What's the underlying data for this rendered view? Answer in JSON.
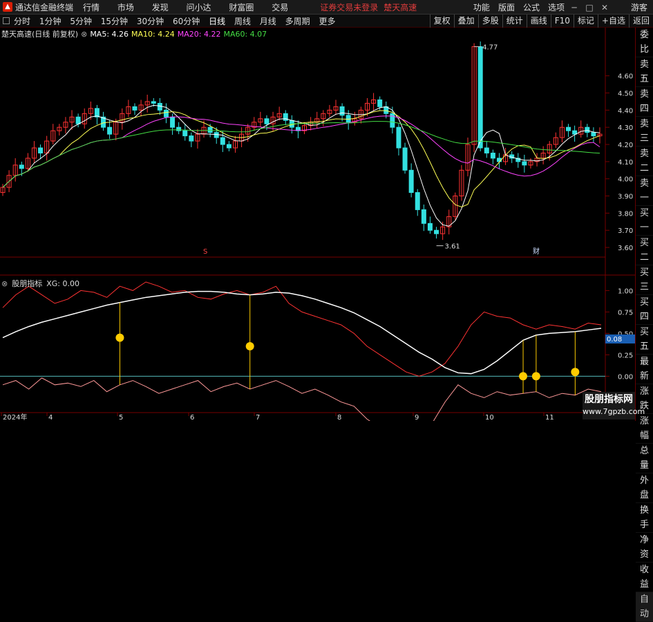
{
  "titlebar": {
    "app_name": "通达信金融终端",
    "menu": [
      "行情",
      "市场",
      "发现",
      "问小达",
      "财富圈",
      "交易"
    ],
    "warning": "证券交易未登录",
    "stock_name": "楚天高速",
    "right_menu": [
      "功能",
      "版面",
      "公式",
      "选项"
    ],
    "guest": "游客"
  },
  "toolbar": {
    "tabs": [
      "分时",
      "1分钟",
      "5分钟",
      "15分钟",
      "30分钟",
      "60分钟",
      "日线",
      "周线",
      "月线",
      "多周期",
      "更多"
    ],
    "active_tab": "日线",
    "right_buttons": [
      "复权",
      "叠加",
      "多股",
      "统计",
      "画线",
      "F10",
      "标记",
      "+自选",
      "返回"
    ]
  },
  "sidebar": {
    "items": [
      "委比",
      "卖五",
      "卖四",
      "卖三",
      "卖二",
      "卖一",
      "买一",
      "买二",
      "买三",
      "买四",
      "买五",
      "最新",
      "涨跌",
      "涨幅",
      "总量",
      "外盘",
      "换手",
      "净资",
      "收益",
      "自动"
    ]
  },
  "main_chart": {
    "label": "楚天高速(日线 前复权)",
    "ma5": "MA5: 4.26",
    "ma10": "MA10: 4.24",
    "ma20": "MA20: 4.22",
    "ma60": "MA60: 4.07",
    "high_label": "4.77",
    "low_label": "3.61",
    "marker_s": "S",
    "marker_cai": "财"
  },
  "indicator": {
    "label": "股朋指标",
    "xg": "XG: 0.00",
    "current_value": "0.08"
  },
  "x_axis": {
    "labels": [
      "2024年",
      "4",
      "5",
      "6",
      "7",
      "8",
      "9",
      "10",
      "11"
    ]
  },
  "watermark": {
    "line1": "股朋指标网",
    "line2": "www.7gpzb.com"
  },
  "colors": {
    "up": "#ff3333",
    "down": "#33e0e0",
    "ma5": "#ffffff",
    "ma10": "#ffff55",
    "ma20": "#ff44ff",
    "ma60": "#44dd44",
    "zero": "#55bbbb",
    "marker": "#ffcc00"
  },
  "chart_data": [
    {
      "type": "candlestick",
      "title": "楚天高速(日线 前复权)",
      "y_ticks": [
        3.6,
        3.7,
        3.8,
        3.9,
        4.0,
        4.1,
        4.2,
        4.3,
        4.4,
        4.5,
        4.6
      ],
      "ylim": [
        3.56,
        4.8
      ],
      "series": [
        {
          "name": "MA5",
          "value": 4.26
        },
        {
          "name": "MA10",
          "value": 4.24
        },
        {
          "name": "MA20",
          "value": 4.22
        },
        {
          "name": "MA60",
          "value": 4.07
        }
      ],
      "annotations": [
        {
          "label": "4.77",
          "value": 4.77
        },
        {
          "label": "3.61",
          "value": 3.61
        }
      ],
      "closes": [
        3.95,
        4.02,
        4.08,
        4.06,
        4.12,
        4.18,
        4.15,
        4.22,
        4.28,
        4.3,
        4.33,
        4.36,
        4.32,
        4.38,
        4.41,
        4.36,
        4.3,
        4.26,
        4.33,
        4.38,
        4.42,
        4.4,
        4.43,
        4.45,
        4.44,
        4.4,
        4.36,
        4.3,
        4.28,
        4.25,
        4.22,
        4.26,
        4.3,
        4.27,
        4.24,
        4.2,
        4.18,
        4.22,
        4.26,
        4.3,
        4.33,
        4.35,
        4.32,
        4.36,
        4.38,
        4.34,
        4.3,
        4.28,
        4.31,
        4.33,
        4.35,
        4.38,
        4.4,
        4.42,
        4.37,
        4.33,
        4.35,
        4.4,
        4.44,
        4.46,
        4.42,
        4.38,
        4.3,
        4.18,
        4.05,
        3.92,
        3.82,
        3.74,
        3.7,
        3.68,
        3.72,
        3.78,
        3.9,
        4.05,
        4.2,
        4.77,
        4.18,
        4.15,
        4.12,
        4.1,
        4.14,
        4.12,
        4.1,
        4.08,
        4.1,
        4.12,
        4.15,
        4.2,
        4.24,
        4.3,
        4.28,
        4.26,
        4.3,
        4.27,
        4.25,
        4.26
      ]
    },
    {
      "type": "line",
      "title": "股朋指标",
      "y_ticks": [
        0.0,
        0.25,
        0.5,
        0.75,
        1.0
      ],
      "ylim": [
        -0.4,
        1.1
      ],
      "current": 0.08,
      "xg": 0.0,
      "white": [
        0.45,
        0.52,
        0.58,
        0.63,
        0.67,
        0.71,
        0.75,
        0.79,
        0.83,
        0.86,
        0.89,
        0.92,
        0.94,
        0.96,
        0.98,
        0.99,
        0.99,
        0.98,
        0.96,
        0.95,
        0.96,
        0.98,
        0.97,
        0.94,
        0.9,
        0.85,
        0.8,
        0.74,
        0.66,
        0.58,
        0.48,
        0.38,
        0.28,
        0.2,
        0.1,
        0.04,
        0.03,
        0.08,
        0.18,
        0.3,
        0.42,
        0.48,
        0.5,
        0.51,
        0.52,
        0.54,
        0.56
      ],
      "red": [
        0.8,
        0.95,
        1.05,
        0.95,
        0.85,
        0.9,
        1.0,
        0.98,
        0.92,
        1.05,
        1.0,
        1.1,
        1.05,
        0.98,
        1.0,
        0.92,
        0.9,
        0.96,
        1.0,
        0.95,
        0.98,
        1.05,
        0.85,
        0.75,
        0.7,
        0.65,
        0.6,
        0.5,
        0.35,
        0.25,
        0.15,
        0.05,
        0.0,
        0.05,
        0.15,
        0.35,
        0.6,
        0.75,
        0.7,
        0.68,
        0.6,
        0.55,
        0.6,
        0.58,
        0.55,
        0.62,
        0.6
      ],
      "pink": [
        -0.1,
        -0.05,
        -0.15,
        -0.02,
        -0.1,
        -0.08,
        -0.12,
        -0.05,
        -0.18,
        -0.1,
        -0.05,
        -0.12,
        -0.2,
        -0.15,
        -0.1,
        -0.05,
        -0.18,
        -0.12,
        -0.08,
        -0.15,
        -0.1,
        -0.05,
        -0.12,
        -0.2,
        -0.15,
        -0.22,
        -0.3,
        -0.35,
        -0.5,
        -0.6,
        -0.7,
        -0.72,
        -0.65,
        -0.55,
        -0.3,
        -0.1,
        -0.2,
        -0.25,
        -0.18,
        -0.22,
        -0.2,
        -0.18,
        -0.25,
        -0.2,
        -0.22,
        -0.15,
        -0.18
      ],
      "markers": [
        0.45,
        0.35,
        0.0,
        0.0,
        0.05
      ]
    }
  ]
}
